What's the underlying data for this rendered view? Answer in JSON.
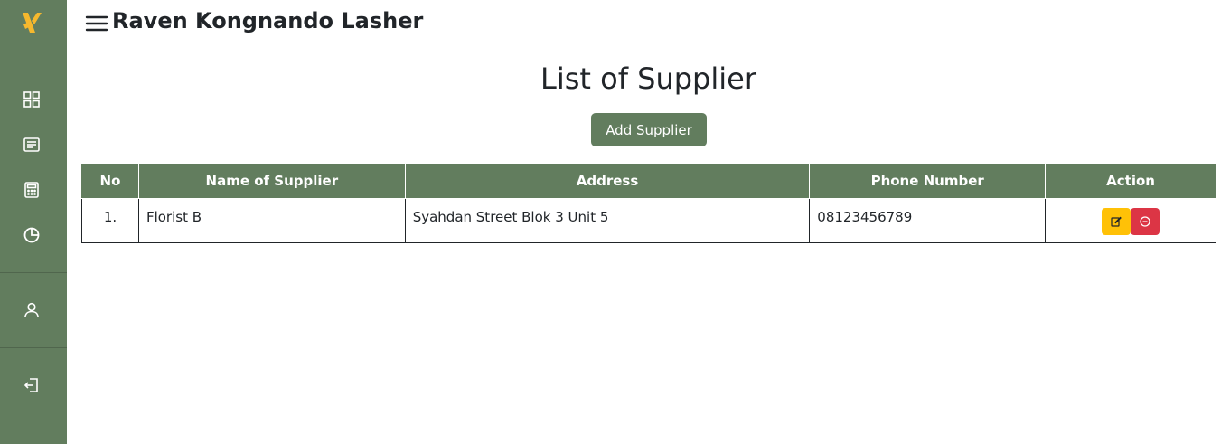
{
  "header": {
    "user_name": "Raven Kongnando Lasher"
  },
  "sidebar": {
    "items": [
      {
        "icon": "dashboard-grid-icon"
      },
      {
        "icon": "document-list-icon"
      },
      {
        "icon": "calculator-icon"
      },
      {
        "icon": "pie-chart-icon"
      },
      {
        "icon": "user-icon"
      },
      {
        "icon": "logout-icon"
      }
    ]
  },
  "main": {
    "title": "List of Supplier",
    "add_button_label": "Add Supplier",
    "table": {
      "headers": [
        "No",
        "Name of Supplier",
        "Address",
        "Phone Number",
        "Action"
      ],
      "rows": [
        {
          "no": "1.",
          "name": "Florist B",
          "address": "Syahdan Street Blok 3 Unit 5",
          "phone": "08123456789"
        }
      ]
    }
  },
  "colors": {
    "brand": "#627d5e",
    "logo": "#f5b82e",
    "edit": "#ffc107",
    "delete": "#dc3545"
  }
}
